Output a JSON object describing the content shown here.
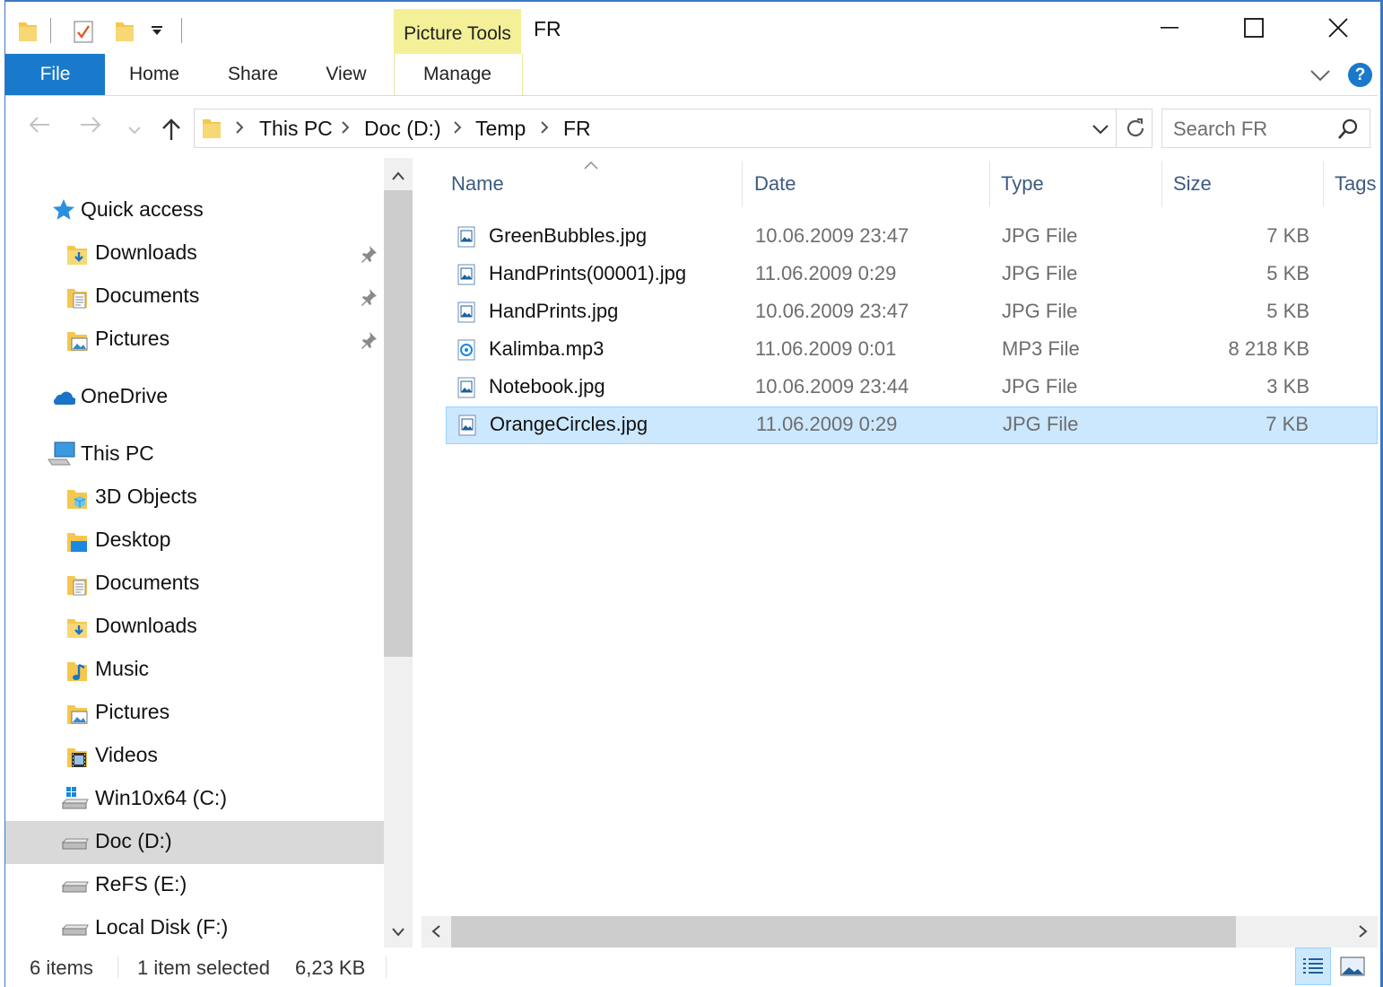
{
  "window": {
    "title": "FR"
  },
  "ribbon": {
    "context_group": "Picture Tools",
    "tabs": [
      {
        "label": "File"
      },
      {
        "label": "Home"
      },
      {
        "label": "Share"
      },
      {
        "label": "View"
      },
      {
        "label": "Manage"
      }
    ],
    "help": "?"
  },
  "address": {
    "breadcrumbs": [
      "This PC",
      "Doc (D:)",
      "Temp",
      "FR"
    ]
  },
  "search": {
    "placeholder": "Search FR"
  },
  "nav": {
    "quick_access": {
      "label": "Quick access",
      "items": [
        {
          "label": "Downloads",
          "icon": "downloads-folder-icon"
        },
        {
          "label": "Documents",
          "icon": "documents-folder-icon"
        },
        {
          "label": "Pictures",
          "icon": "pictures-folder-icon"
        }
      ]
    },
    "onedrive": {
      "label": "OneDrive"
    },
    "this_pc": {
      "label": "This PC",
      "items": [
        {
          "label": "3D Objects",
          "icon": "3d-objects-folder-icon"
        },
        {
          "label": "Desktop",
          "icon": "desktop-folder-icon"
        },
        {
          "label": "Documents",
          "icon": "documents-folder-icon"
        },
        {
          "label": "Downloads",
          "icon": "downloads-folder-icon"
        },
        {
          "label": "Music",
          "icon": "music-folder-icon"
        },
        {
          "label": "Pictures",
          "icon": "pictures-folder-icon"
        },
        {
          "label": "Videos",
          "icon": "videos-folder-icon"
        },
        {
          "label": "Win10x64 (C:)",
          "icon": "windows-drive-icon"
        },
        {
          "label": "Doc (D:)",
          "icon": "drive-icon",
          "selected": true
        },
        {
          "label": "ReFS (E:)",
          "icon": "drive-icon"
        },
        {
          "label": "Local Disk (F:)",
          "icon": "drive-icon"
        }
      ]
    }
  },
  "columns": {
    "name": "Name",
    "date": "Date",
    "type": "Type",
    "size": "Size",
    "tags": "Tags"
  },
  "files": [
    {
      "name": "GreenBubbles.jpg",
      "date": "10.06.2009 23:47",
      "type": "JPG File",
      "size": "7 KB",
      "icon": "image-file-icon"
    },
    {
      "name": "HandPrints(00001).jpg",
      "date": "11.06.2009 0:29",
      "type": "JPG File",
      "size": "5 KB",
      "icon": "image-file-icon"
    },
    {
      "name": "HandPrints.jpg",
      "date": "10.06.2009 23:47",
      "type": "JPG File",
      "size": "5 KB",
      "icon": "image-file-icon"
    },
    {
      "name": "Kalimba.mp3",
      "date": "11.06.2009 0:01",
      "type": "MP3 File",
      "size": "8 218 KB",
      "icon": "audio-file-icon"
    },
    {
      "name": "Notebook.jpg",
      "date": "10.06.2009 23:44",
      "type": "JPG File",
      "size": "3 KB",
      "icon": "image-file-icon"
    },
    {
      "name": "OrangeCircles.jpg",
      "date": "11.06.2009 0:29",
      "type": "JPG File",
      "size": "7 KB",
      "icon": "image-file-icon",
      "selected": true
    }
  ],
  "status": {
    "items": "6 items",
    "selection": "1 item selected",
    "selection_size": "6,23 KB"
  },
  "colors": {
    "accent": "#1979ca",
    "selection": "#cce8ff",
    "context_tab": "#f3f098"
  }
}
